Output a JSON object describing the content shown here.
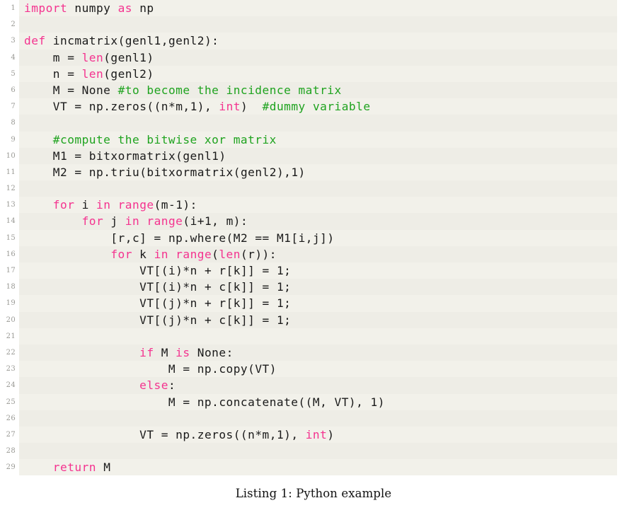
{
  "listing": {
    "language": "Python",
    "caption": "Listing 1: Python example",
    "first_line_number": 1,
    "line_count": 29,
    "colors": {
      "background_odd": "#f2f1ea",
      "background_even": "#eeede6",
      "keyword": "#f4338f",
      "comment": "#1fa31f",
      "text": "#1a1a1a",
      "line_number": "#9a9a95",
      "page": "#ffffff"
    },
    "lines": [
      {
        "n": "1",
        "text": "import numpy as np"
      },
      {
        "n": "2",
        "text": ""
      },
      {
        "n": "3",
        "text": "def incmatrix(genl1,genl2):"
      },
      {
        "n": "4",
        "text": "    m = len(genl1)"
      },
      {
        "n": "5",
        "text": "    n = len(genl2)"
      },
      {
        "n": "6",
        "text": "    M = None #to become the incidence matrix"
      },
      {
        "n": "7",
        "text": "    VT = np.zeros((n*m,1), int)  #dummy variable"
      },
      {
        "n": "8",
        "text": ""
      },
      {
        "n": "9",
        "text": "    #compute the bitwise xor matrix"
      },
      {
        "n": "10",
        "text": "    M1 = bitxormatrix(genl1)"
      },
      {
        "n": "11",
        "text": "    M2 = np.triu(bitxormatrix(genl2),1)"
      },
      {
        "n": "12",
        "text": ""
      },
      {
        "n": "13",
        "text": "    for i in range(m-1):"
      },
      {
        "n": "14",
        "text": "        for j in range(i+1, m):"
      },
      {
        "n": "15",
        "text": "            [r,c] = np.where(M2 == M1[i,j])"
      },
      {
        "n": "16",
        "text": "            for k in range(len(r)):"
      },
      {
        "n": "17",
        "text": "                VT[(i)*n + r[k]] = 1;"
      },
      {
        "n": "18",
        "text": "                VT[(i)*n + c[k]] = 1;"
      },
      {
        "n": "19",
        "text": "                VT[(j)*n + r[k]] = 1;"
      },
      {
        "n": "20",
        "text": "                VT[(j)*n + c[k]] = 1;"
      },
      {
        "n": "21",
        "text": ""
      },
      {
        "n": "22",
        "text": "                if M is None:"
      },
      {
        "n": "23",
        "text": "                    M = np.copy(VT)"
      },
      {
        "n": "24",
        "text": "                else:"
      },
      {
        "n": "25",
        "text": "                    M = np.concatenate((M, VT), 1)"
      },
      {
        "n": "26",
        "text": ""
      },
      {
        "n": "27",
        "text": "                VT = np.zeros((n*m,1), int)"
      },
      {
        "n": "28",
        "text": ""
      },
      {
        "n": "29",
        "text": "    return M"
      }
    ],
    "tokens": {
      "keywords": [
        "import",
        "as",
        "def",
        "len",
        "int",
        "for",
        "in",
        "range",
        "if",
        "is",
        "else",
        "return"
      ],
      "comment_prefix": "#"
    }
  }
}
